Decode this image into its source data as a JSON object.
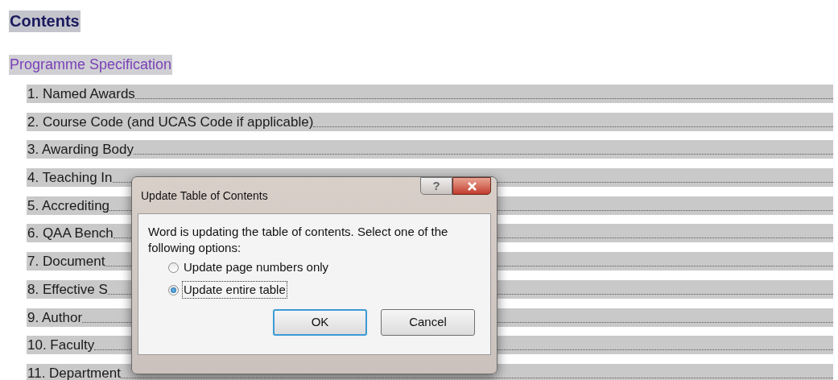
{
  "document": {
    "heading": "Contents",
    "section": "Programme Specification",
    "entries": [
      "1. Named Awards",
      "2. Course Code (and UCAS Code if applicable)",
      "3. Awarding Body",
      "4. Teaching In",
      "5. Accrediting",
      "6. QAA Bench",
      "7. Document",
      "8. Effective S",
      "9. Author",
      "10. Faculty",
      "11. Department"
    ]
  },
  "dialog": {
    "title": "Update Table of Contents",
    "help_button": "?",
    "message": "Word is updating the table of contents.  Select one of the following options:",
    "options": [
      {
        "label": "Update page numbers only",
        "selected": false
      },
      {
        "label": "Update entire table",
        "selected": true
      }
    ],
    "buttons": [
      {
        "label": "OK",
        "default": true
      },
      {
        "label": "Cancel",
        "default": false
      }
    ]
  }
}
